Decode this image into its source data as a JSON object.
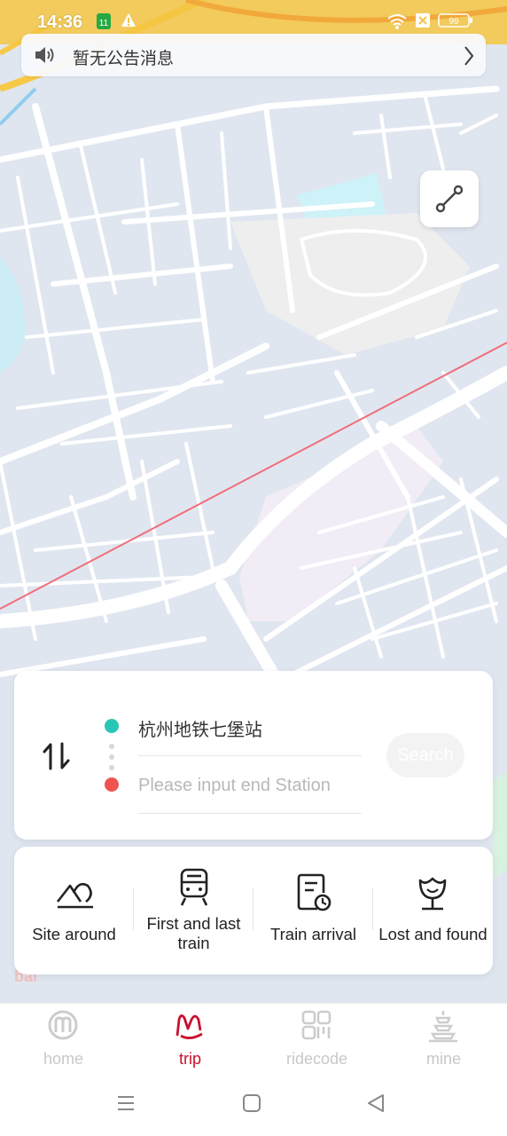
{
  "status_bar": {
    "time": "14:36",
    "battery": "99"
  },
  "notice": {
    "text": "暂无公告消息"
  },
  "search": {
    "start_station": "杭州地铁七堡站",
    "end_placeholder": "Please input end Station",
    "button_label": "Search"
  },
  "features": [
    {
      "label": "Site around",
      "icon": "mountain-sun-icon"
    },
    {
      "label": "First and last train",
      "icon": "train-icon"
    },
    {
      "label": "Train arrival",
      "icon": "schedule-clock-icon"
    },
    {
      "label": "Lost and found",
      "icon": "tulip-icon"
    }
  ],
  "bottom_nav": [
    {
      "label": "home",
      "icon": "metro-logo-icon",
      "active": false
    },
    {
      "label": "trip",
      "icon": "trip-icon",
      "active": true
    },
    {
      "label": "ridecode",
      "icon": "qr-code-icon",
      "active": false
    },
    {
      "label": "mine",
      "icon": "pagoda-icon",
      "active": false
    }
  ],
  "colors": {
    "accent_red": "#c8102e",
    "start_dot": "#28c6b5",
    "end_dot": "#ef5350",
    "inactive_nav": "#c8c8c8"
  }
}
